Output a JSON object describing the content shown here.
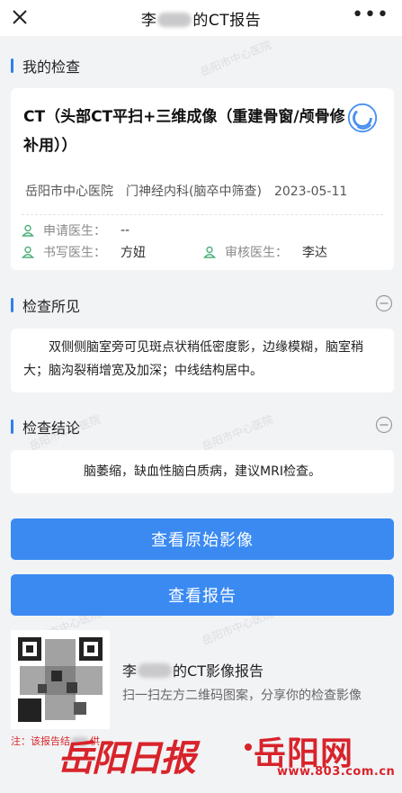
{
  "header": {
    "title_prefix": "李",
    "title_suffix": "的CT报告",
    "close_icon": "close-icon",
    "more_label": "•••"
  },
  "my_exam": {
    "section_title": "我的检查",
    "exam_name": "CT（头部CT平扫+三维成像（重建骨窗/颅骨修补用））",
    "hospital": "岳阳市中心医院",
    "department": "门神经内科(脑卒中筛查)",
    "date": "2023-05-11",
    "doctors": {
      "applicant_label": "申请医生：",
      "applicant_value": "--",
      "writer_label": "书写医生：",
      "writer_value": "方妞",
      "reviewer_label": "审核医生：",
      "reviewer_value": "李达"
    }
  },
  "findings": {
    "section_title": "检查所见",
    "text": "双侧侧脑室旁可见斑点状稍低密度影，边缘模糊，脑室稍大；脑沟裂稍增宽及加深；中线结构居中。"
  },
  "conclusion": {
    "section_title": "检查结论",
    "text": "脑萎缩，缺血性脑白质病，建议MRI检查。"
  },
  "buttons": {
    "view_images": "查看原始影像",
    "view_report": "查看报告"
  },
  "share": {
    "title_prefix": "李",
    "title_suffix": "的CT影像报告",
    "subtitle": "扫一扫左方二维码图案，分享你的检查影像",
    "note": "注：该报告结",
    "note_tail": "供"
  },
  "watermark": "岳阳市中心医院",
  "brand": {
    "script": "岳阳日报",
    "name": "岳阳网",
    "url": "www.803.com.cn"
  },
  "colors": {
    "accent": "#3a8af2",
    "brand_red": "#d8232a",
    "background": "#f2f3f5"
  }
}
